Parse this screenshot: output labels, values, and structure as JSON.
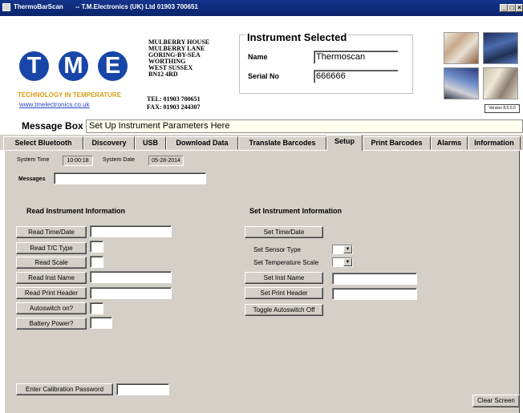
{
  "window": {
    "title": "ThermoBarScan",
    "company": "--  T.M.Electronics (UK) Ltd  01903 700651"
  },
  "company": {
    "logo_letters": [
      "T",
      "M",
      "E"
    ],
    "tagline": "TECHNOLOGY IN TEMPERATURE",
    "website": "www.tmelectronics.co.uk",
    "address_lines": [
      "MULBERRY HOUSE",
      "MULBERRY LANE",
      "GORING-BY-SEA",
      "WORTHING",
      "WEST SUSSEX",
      "BN12 4RD"
    ],
    "tel": "TEL:  01903 700651",
    "fax": "FAX:  01903 244307",
    "version": "Version 8.5.0.0"
  },
  "instrument": {
    "title": "Instrument Selected",
    "name_label": "Name",
    "name_value": "Thermoscan",
    "serial_label": "Serial No",
    "serial_value": "666666"
  },
  "message": {
    "label": "Message Box",
    "text": "Set Up Instrument Parameters Here"
  },
  "tabs": [
    {
      "label": "Select Bluetooth",
      "active": false
    },
    {
      "label": "Discovery",
      "active": false
    },
    {
      "label": "USB",
      "active": false
    },
    {
      "label": "Download Data",
      "active": false
    },
    {
      "label": "Translate Barcodes",
      "active": false
    },
    {
      "label": "Setup",
      "active": true
    },
    {
      "label": "Print Barcodes",
      "active": false
    },
    {
      "label": "Alarms",
      "active": false
    },
    {
      "label": "Information",
      "active": false
    }
  ],
  "setup": {
    "system_time_label": "System Time",
    "system_time": "10:00:18",
    "system_date_label": "System Date",
    "system_date": "05-28-2014",
    "messages_label": "Messages",
    "read_section": "Read Instrument Information",
    "set_section": "Set Instrument Information",
    "read_buttons": [
      "Read Time/Date",
      "Read T/C Type",
      "Read Scale",
      "Read Inst Name",
      "Read Print Header",
      "Autoswitch on?",
      "Battery Power?"
    ],
    "set_time_button": "Set Time/Date",
    "sensor_type_label": "Set Sensor Type",
    "temp_scale_label": "Set Temperature Scale",
    "set_inst_name_button": "Set Inst Name",
    "set_print_header_button": "Set Print Header",
    "toggle_autoswitch_button": "Toggle Autoswitch Off",
    "calibration_button": "Enter Calibration Password",
    "clear_button": "Clear Screen"
  },
  "colors": {
    "title_bar": "#0a246a",
    "logo_blue": "#1846a8",
    "tagline_gold": "#d2a016",
    "message_bg": "#ffffee",
    "panel_bg": "#d4d0c8"
  },
  "icons": {
    "minimize": "minimize-icon",
    "maximize": "maximize-icon",
    "close": "close-icon",
    "dropdown": "chevron-down-icon"
  }
}
